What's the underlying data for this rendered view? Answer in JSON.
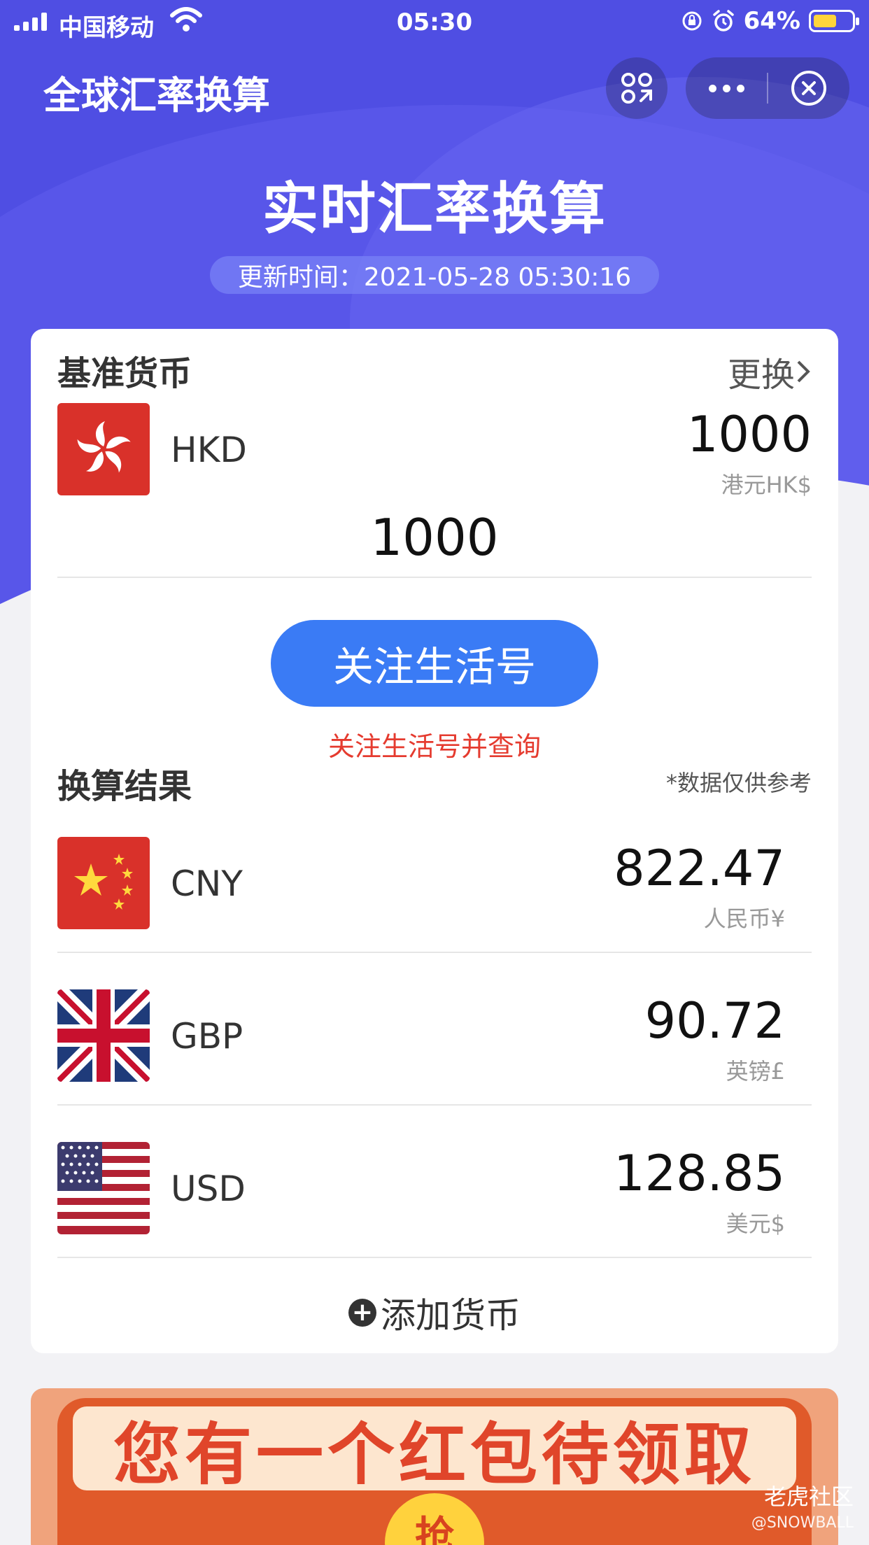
{
  "status_bar": {
    "carrier": "中国移动",
    "time": "05:30",
    "battery": "64%"
  },
  "nav": {
    "title": "全球汇率换算"
  },
  "hero": {
    "title": "实时汇率换算",
    "update_text": "更新时间：2021-05-28 05:30:16"
  },
  "base": {
    "section_title": "基准货币",
    "change_label": "更换",
    "code": "HKD",
    "amount": "1000",
    "unit": "港元HK$",
    "input_value": "1000"
  },
  "follow": {
    "button_label": "关注生活号",
    "hint": "关注生活号并查询"
  },
  "results": {
    "section_title": "换算结果",
    "disclaimer": "*数据仅供参考",
    "items": [
      {
        "code": "CNY",
        "amount": "822.47",
        "unit": "人民币¥"
      },
      {
        "code": "GBP",
        "amount": "90.72",
        "unit": "英镑£"
      },
      {
        "code": "USD",
        "amount": "128.85",
        "unit": "美元$"
      }
    ]
  },
  "add_currency_label": "添加货币",
  "banner": {
    "text": "您有一个红包待领取",
    "coin": "抢"
  },
  "watermark": {
    "main": "老虎社区",
    "sub": "@SNOWBALL"
  },
  "colors": {
    "hero": "#4f4ee3",
    "primary_button": "#3a7bf5",
    "hint_red": "#e53b2f"
  }
}
